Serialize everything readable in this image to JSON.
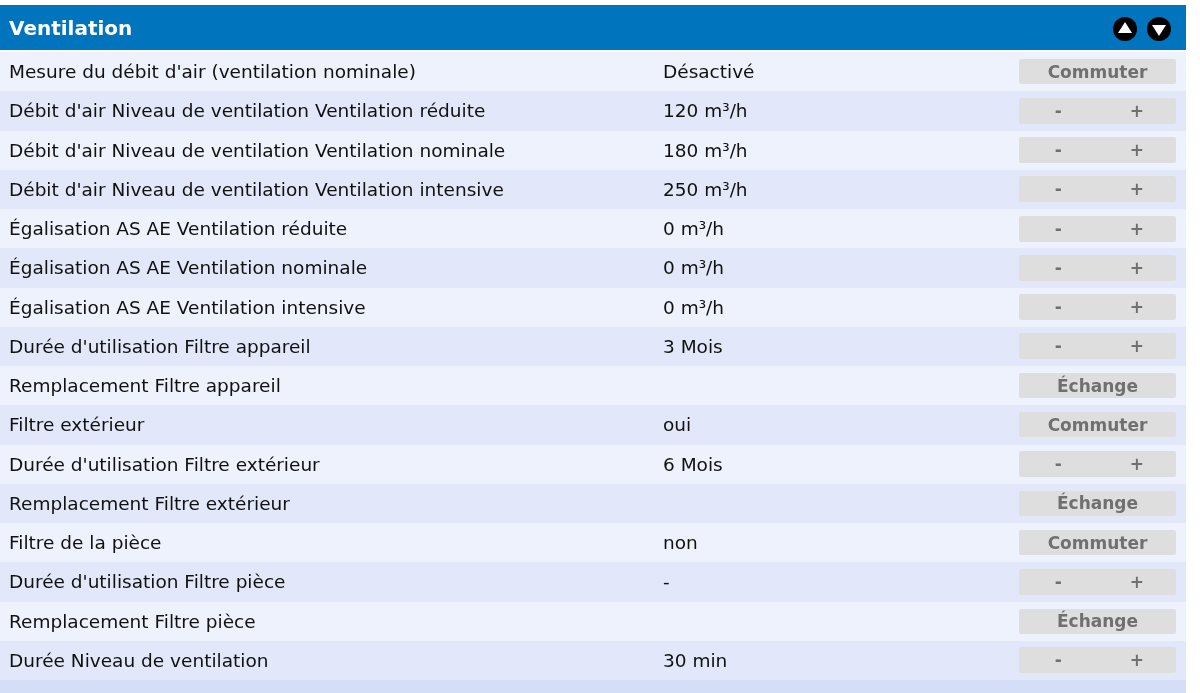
{
  "panel": {
    "title": "Ventilation"
  },
  "rows": [
    {
      "label": "Mesure du débit d'air (ventilation nominale)",
      "value": "Désactivé",
      "control": {
        "kind": "button",
        "label": "Commuter"
      }
    },
    {
      "label": "Débit d'air Niveau de ventilation Ventilation réduite",
      "value": "120 m³/h",
      "control": {
        "kind": "stepper",
        "minus": "-",
        "plus": "+"
      }
    },
    {
      "label": "Débit d'air Niveau de ventilation Ventilation nominale",
      "value": "180 m³/h",
      "control": {
        "kind": "stepper",
        "minus": "-",
        "plus": "+"
      }
    },
    {
      "label": "Débit d'air Niveau de ventilation Ventilation intensive",
      "value": "250 m³/h",
      "control": {
        "kind": "stepper",
        "minus": "-",
        "plus": "+"
      }
    },
    {
      "label": "Égalisation AS AE Ventilation réduite",
      "value": "0 m³/h",
      "control": {
        "kind": "stepper",
        "minus": "-",
        "plus": "+"
      }
    },
    {
      "label": "Égalisation AS AE Ventilation nominale",
      "value": "0 m³/h",
      "control": {
        "kind": "stepper",
        "minus": "-",
        "plus": "+"
      }
    },
    {
      "label": "Égalisation AS AE Ventilation intensive",
      "value": "0 m³/h",
      "control": {
        "kind": "stepper",
        "minus": "-",
        "plus": "+"
      }
    },
    {
      "label": "Durée d'utilisation Filtre appareil",
      "value": "3 Mois",
      "control": {
        "kind": "stepper",
        "minus": "-",
        "plus": "+"
      }
    },
    {
      "label": "Remplacement Filtre appareil",
      "control": {
        "kind": "button",
        "label": "Échange"
      }
    },
    {
      "label": "Filtre extérieur",
      "value": "oui",
      "control": {
        "kind": "button",
        "label": "Commuter"
      }
    },
    {
      "label": "Durée d'utilisation Filtre extérieur",
      "value": "6 Mois",
      "control": {
        "kind": "stepper",
        "minus": "-",
        "plus": "+"
      }
    },
    {
      "label": "Remplacement Filtre extérieur",
      "control": {
        "kind": "button",
        "label": "Échange"
      }
    },
    {
      "label": "Filtre de la pièce",
      "value": "non",
      "control": {
        "kind": "button",
        "label": "Commuter"
      }
    },
    {
      "label": "Durée d'utilisation Filtre pièce",
      "value": "-",
      "control": {
        "kind": "stepper",
        "minus": "-",
        "plus": "+"
      }
    },
    {
      "label": "Remplacement Filtre pièce",
      "control": {
        "kind": "button",
        "label": "Échange"
      }
    },
    {
      "label": "Durée Niveau de ventilation",
      "value": "30 min",
      "control": {
        "kind": "stepper",
        "minus": "-",
        "plus": "+"
      }
    }
  ]
}
